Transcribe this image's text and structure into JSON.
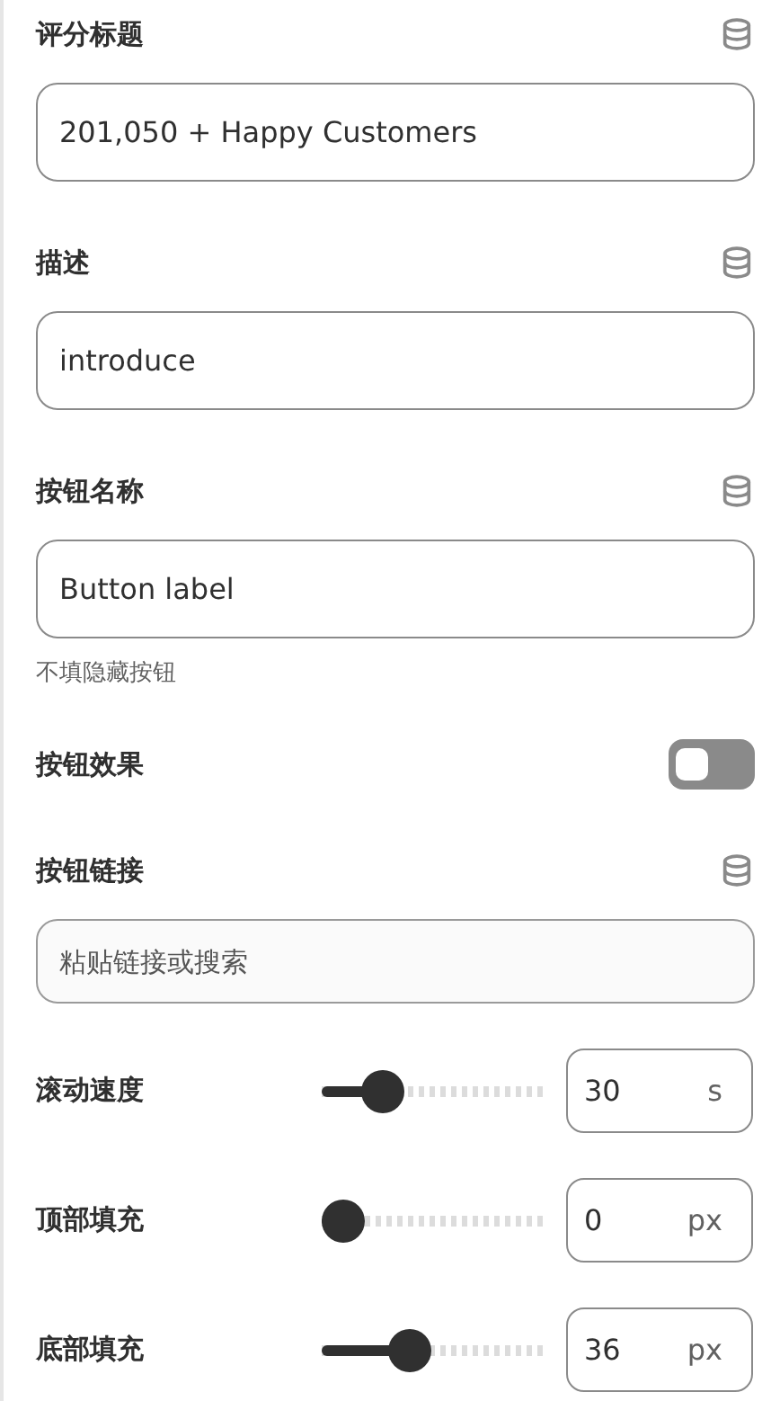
{
  "fields": [
    {
      "kind": "text",
      "label": "评分标题",
      "value": "201,050 + Happy Customers"
    },
    {
      "kind": "text",
      "label": "描述",
      "value": "introduce"
    },
    {
      "kind": "text",
      "label": "按钮名称",
      "value": "Button label",
      "hint": "不填隐藏按钮"
    },
    {
      "kind": "toggle",
      "label": "按钮效果",
      "on": false
    },
    {
      "kind": "link",
      "label": "按钮链接",
      "placeholder": "粘贴链接或搜索"
    },
    {
      "kind": "slider",
      "label": "滚动速度",
      "level": 0.22,
      "value": "30",
      "unit": "s"
    },
    {
      "kind": "slider",
      "label": "顶部填充",
      "level": 0,
      "value": "0",
      "unit": "px"
    },
    {
      "kind": "slider",
      "label": "底部填充",
      "level": 0.37,
      "value": "36",
      "unit": "px"
    }
  ]
}
